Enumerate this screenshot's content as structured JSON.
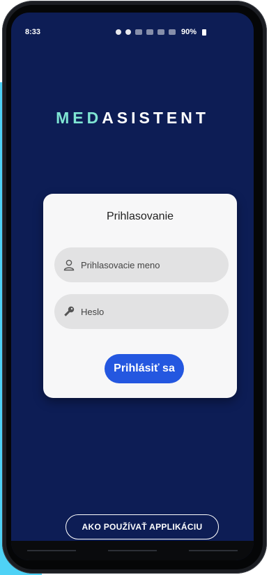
{
  "status_bar": {
    "time": "8:33",
    "battery": "90%"
  },
  "brand": {
    "part1": "MED",
    "part2": "ASISTENT",
    "accent_color": "#7fe5d3"
  },
  "login_card": {
    "title": "Prihlasovanie",
    "username_placeholder": "Prihlasovacie meno",
    "password_placeholder": "Heslo",
    "submit_label": "Prihlásiť sa"
  },
  "footer": {
    "howto_label": "AKO POUŽÍVAŤ APPLIKÁCIU"
  },
  "colors": {
    "background": "#0d1d55",
    "primary_button": "#2457e0",
    "side_panel": "#4fd2f6"
  }
}
